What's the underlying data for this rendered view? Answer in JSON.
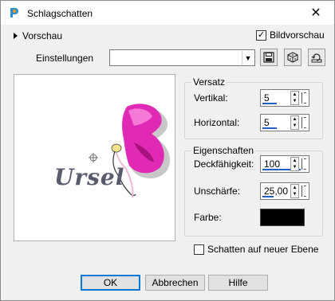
{
  "window": {
    "title": "Schlagschatten",
    "close_glyph": "✕"
  },
  "preview_toggle": {
    "label": "Vorschau"
  },
  "image_preview": {
    "label": "Bildvorschau",
    "checked": true
  },
  "settings": {
    "label": "Einstellungen",
    "value": ""
  },
  "preview_text": "Ursel",
  "offset": {
    "title": "Versatz",
    "vertical_label": "Vertikal:",
    "vertical_value": "5",
    "horizontal_label": "Horizontal:",
    "horizontal_value": "5"
  },
  "properties": {
    "title": "Eigenschaften",
    "opacity_label": "Deckfähigkeit:",
    "opacity_value": "100",
    "blur_label": "Unschärfe:",
    "blur_value": "25,00",
    "color_label": "Farbe:",
    "color_value": "#000000"
  },
  "shadow_layer": {
    "label": "Schatten auf neuer Ebene",
    "checked": false
  },
  "buttons": {
    "ok": "OK",
    "cancel": "Abbrechen",
    "help": "Hilfe"
  }
}
